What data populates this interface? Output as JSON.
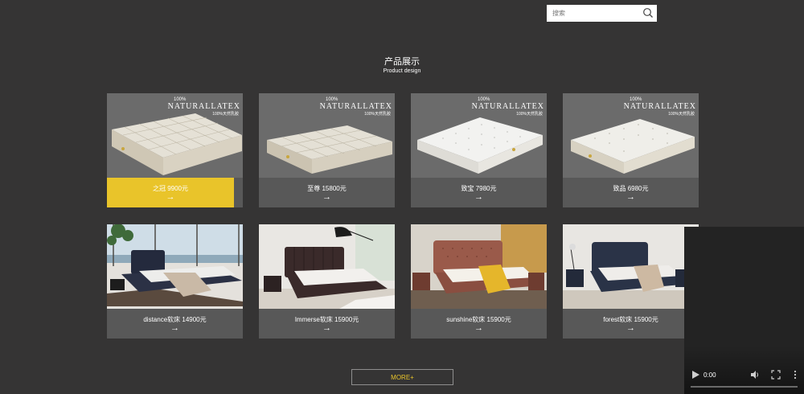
{
  "search": {
    "placeholder": "搜索"
  },
  "section": {
    "title": "产品展示",
    "subtitle": "Product design"
  },
  "brand": {
    "top": "100%",
    "main": "NATURALLATEX",
    "sub": "100%天然乳胶"
  },
  "products": [
    {
      "label": "之冠 9900元",
      "arrow": "→"
    },
    {
      "label": "至尊 15800元",
      "arrow": "→"
    },
    {
      "label": "致宝 7980元",
      "arrow": "→"
    },
    {
      "label": "致品 6980元",
      "arrow": "→"
    },
    {
      "label": "distance软床 14900元",
      "arrow": "→"
    },
    {
      "label": "Immerse软床 15900元",
      "arrow": "→"
    },
    {
      "label": "sunshine软床 15900元",
      "arrow": "→"
    },
    {
      "label": "forest软床 15900元",
      "arrow": "→"
    }
  ],
  "more": {
    "label": "MORE+"
  },
  "video": {
    "time": "0:00"
  },
  "colors": {
    "background": "#353434",
    "accent": "#e9c42a",
    "card": "#585858"
  }
}
